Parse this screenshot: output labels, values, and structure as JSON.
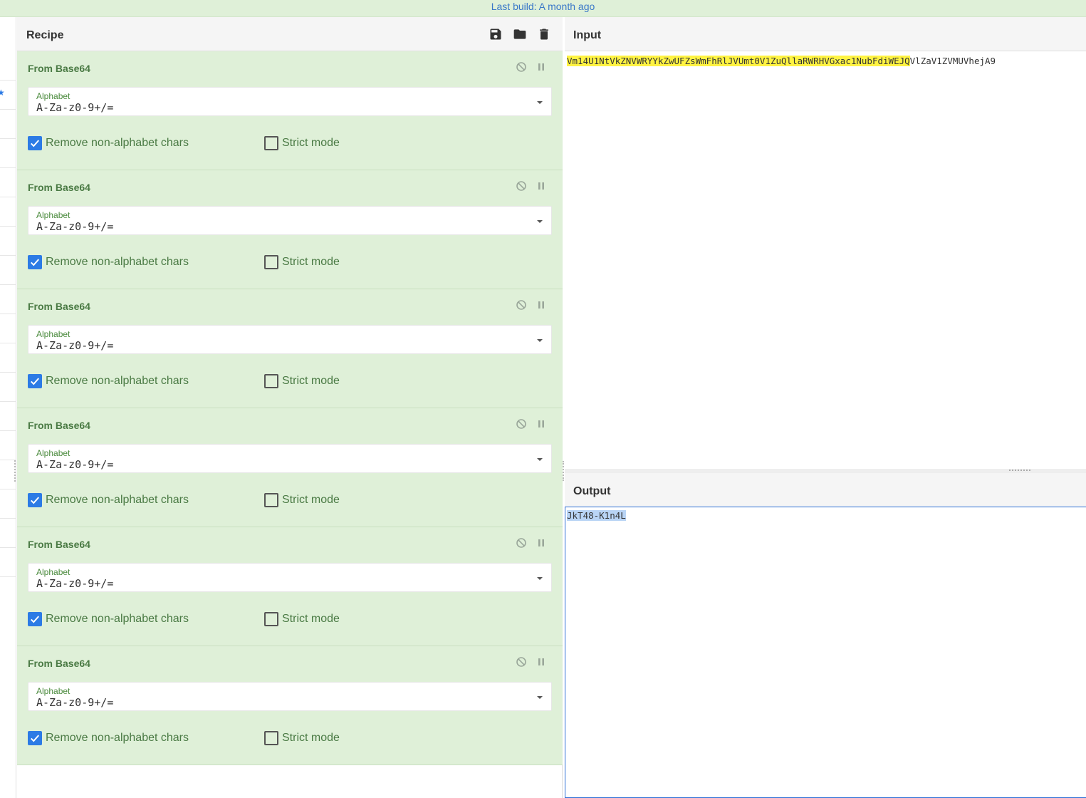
{
  "topbar": {
    "build_text": "Last build: A month ago"
  },
  "recipe": {
    "title": "Recipe",
    "header_icons": [
      "save-icon",
      "folder-icon",
      "trash-icon"
    ],
    "operations": [
      {
        "name": "From Base64",
        "alphabet_label": "Alphabet",
        "alphabet_value": "A-Za-z0-9+/=",
        "remove_label": "Remove non-alphabet chars",
        "remove_checked": true,
        "strict_label": "Strict mode",
        "strict_checked": false
      },
      {
        "name": "From Base64",
        "alphabet_label": "Alphabet",
        "alphabet_value": "A-Za-z0-9+/=",
        "remove_label": "Remove non-alphabet chars",
        "remove_checked": true,
        "strict_label": "Strict mode",
        "strict_checked": false
      },
      {
        "name": "From Base64",
        "alphabet_label": "Alphabet",
        "alphabet_value": "A-Za-z0-9+/=",
        "remove_label": "Remove non-alphabet chars",
        "remove_checked": true,
        "strict_label": "Strict mode",
        "strict_checked": false
      },
      {
        "name": "From Base64",
        "alphabet_label": "Alphabet",
        "alphabet_value": "A-Za-z0-9+/=",
        "remove_label": "Remove non-alphabet chars",
        "remove_checked": true,
        "strict_label": "Strict mode",
        "strict_checked": false
      },
      {
        "name": "From Base64",
        "alphabet_label": "Alphabet",
        "alphabet_value": "A-Za-z0-9+/=",
        "remove_label": "Remove non-alphabet chars",
        "remove_checked": true,
        "strict_label": "Strict mode",
        "strict_checked": false
      },
      {
        "name": "From Base64",
        "alphabet_label": "Alphabet",
        "alphabet_value": "A-Za-z0-9+/=",
        "remove_label": "Remove non-alphabet chars",
        "remove_checked": true,
        "strict_label": "Strict mode",
        "strict_checked": false
      }
    ]
  },
  "input": {
    "title": "Input",
    "highlighted": "Vm14U1NtVkZNVWRYYkZwUFZsWmFhRlJVUmt0V1ZuQllaRWRHVGxac1NubFdiWEJQ",
    "rest": "VlZaV1ZVMUVhejA9"
  },
  "output": {
    "title": "Output",
    "text": "JkT48-K1n4L"
  },
  "colors": {
    "accent": "#2c7be5",
    "op_background": "#dff0d8",
    "op_text": "#4a7a44",
    "highlight": "#fff342",
    "selection": "#b9d4f5"
  }
}
